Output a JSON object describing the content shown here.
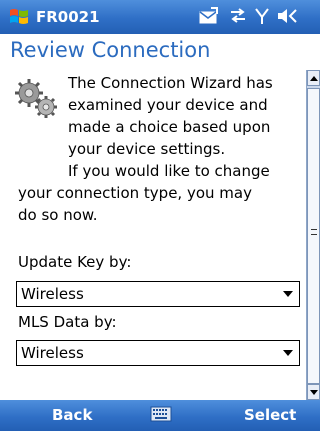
{
  "statusbar": {
    "app_title": "FR0021",
    "icons": [
      "windows-flag-icon",
      "email-icon",
      "connectivity-icon",
      "signal-icon",
      "volume-icon"
    ]
  },
  "page": {
    "title": "Review Connection",
    "description_lines": [
      "The Connection Wizard has",
      "examined your device and",
      "made a choice based upon",
      "your device settings.",
      "If you would like to change",
      "your connection type, you may",
      "do so now."
    ]
  },
  "form": {
    "update_key_label": "Update Key by:",
    "update_key_value": "Wireless",
    "mls_data_label": "MLS Data by:",
    "mls_data_value": "Wireless"
  },
  "softkeys": {
    "left": "Back",
    "right": "Select"
  },
  "colors": {
    "bar_blue": "#2f6fc6",
    "title_blue": "#2b6bbf"
  }
}
